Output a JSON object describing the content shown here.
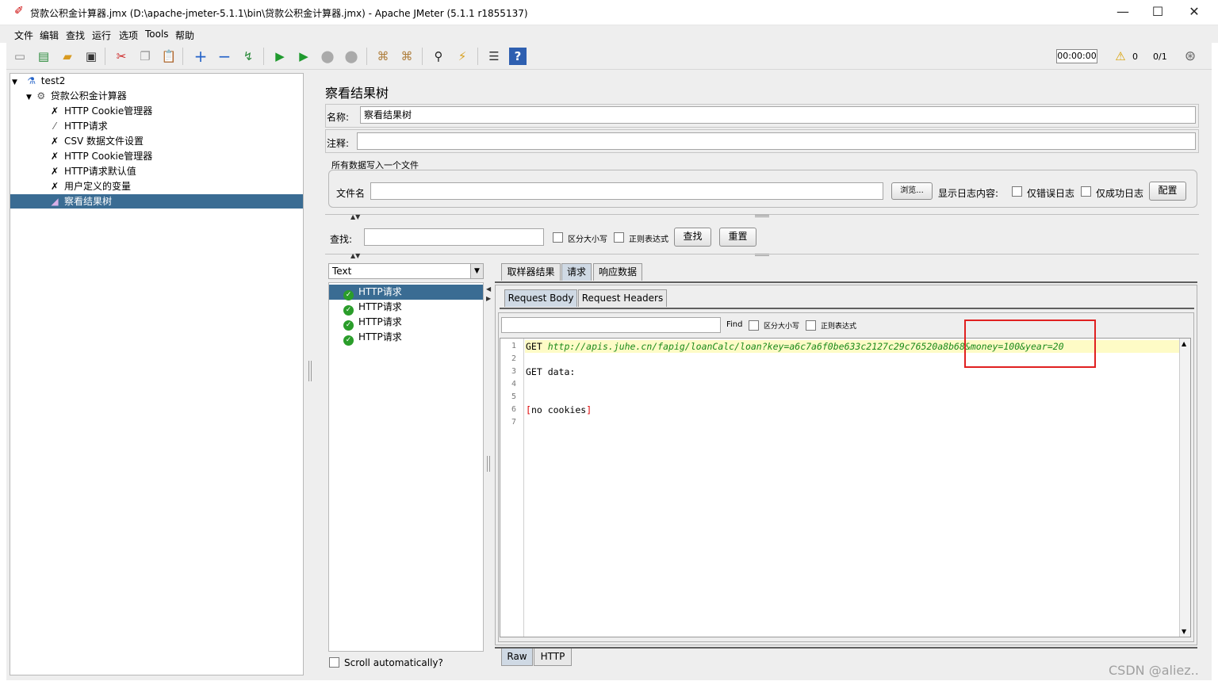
{
  "window": {
    "title": "贷款公积金计算器.jmx (D:\\apache-jmeter-5.1.1\\bin\\贷款公积金计算器.jmx) - Apache JMeter (5.1.1 r1855137)",
    "minimize": "—",
    "maximize": "☐",
    "close": "✕"
  },
  "menu": [
    "文件",
    "编辑",
    "查找",
    "运行",
    "选项",
    "Tools",
    "帮助"
  ],
  "toolbar": {
    "timer": "00:00:00",
    "warnings": "0",
    "threads": "0/1"
  },
  "tree": [
    {
      "label": "test2",
      "icon": "test-plan-icon",
      "indent": 0,
      "expanded": true
    },
    {
      "label": "贷款公积金计算器",
      "icon": "thread-group-icon",
      "indent": 1,
      "expanded": true
    },
    {
      "label": "HTTP Cookie管理器",
      "icon": "config-element-icon",
      "indent": 2
    },
    {
      "label": "HTTP请求",
      "icon": "sampler-icon",
      "indent": 2
    },
    {
      "label": "CSV 数据文件设置",
      "icon": "config-element-icon",
      "indent": 2
    },
    {
      "label": "HTTP Cookie管理器",
      "icon": "config-element-icon",
      "indent": 2
    },
    {
      "label": "HTTP请求默认值",
      "icon": "config-element-icon",
      "indent": 2
    },
    {
      "label": "用户定义的变量",
      "icon": "config-element-icon",
      "indent": 2
    },
    {
      "label": "察看结果树",
      "icon": "listener-icon",
      "indent": 2,
      "selected": true
    }
  ],
  "panel": {
    "title": "察看结果树",
    "name_label": "名称:",
    "name_value": "察看结果树",
    "comment_label": "注释:",
    "comment_value": "",
    "file_group_title": "所有数据写入一个文件",
    "filename_label": "文件名",
    "filename_value": "",
    "browse_button": "浏览...",
    "log_content_label": "显示日志内容:",
    "errors_only_label": "仅错误日志",
    "success_only_label": "仅成功日志",
    "configure_button": "配置",
    "search_label": "查找:",
    "search_value": "",
    "case_sensitive_label": "区分大小写",
    "regex_label": "正则表达式",
    "find_button": "查找",
    "reset_button": "重置"
  },
  "renderer": {
    "selected": "Text"
  },
  "results": [
    {
      "label": "HTTP请求",
      "status": "success",
      "selected": true
    },
    {
      "label": "HTTP请求",
      "status": "success"
    },
    {
      "label": "HTTP请求",
      "status": "success"
    },
    {
      "label": "HTTP请求",
      "status": "success"
    }
  ],
  "scroll_auto_label": "Scroll automatically?",
  "result_tabs": [
    "取样器结果",
    "请求",
    "响应数据"
  ],
  "request_tabs": [
    "Request Body",
    "Request Headers"
  ],
  "editor_find": {
    "value": "",
    "find_label": "Find",
    "case_sensitive_label": "区分大小写",
    "regex_label": "正则表达式"
  },
  "editor": {
    "line_numbers": [
      "1",
      "2",
      "3",
      "4",
      "5",
      "6",
      "7"
    ],
    "line1_method": "GET ",
    "line1_url": "http://apis.juhe.cn/fapig/loanCalc/loan?key=a6c7a6f0be633c2127c29c76520a8b68&money=100&year=20",
    "line3": "GET data:",
    "line6_open": "[",
    "line6_text": "no cookies",
    "line6_close": "]"
  },
  "bottom_tabs": [
    "Raw",
    "HTTP"
  ],
  "watermark": "CSDN @aliez.."
}
